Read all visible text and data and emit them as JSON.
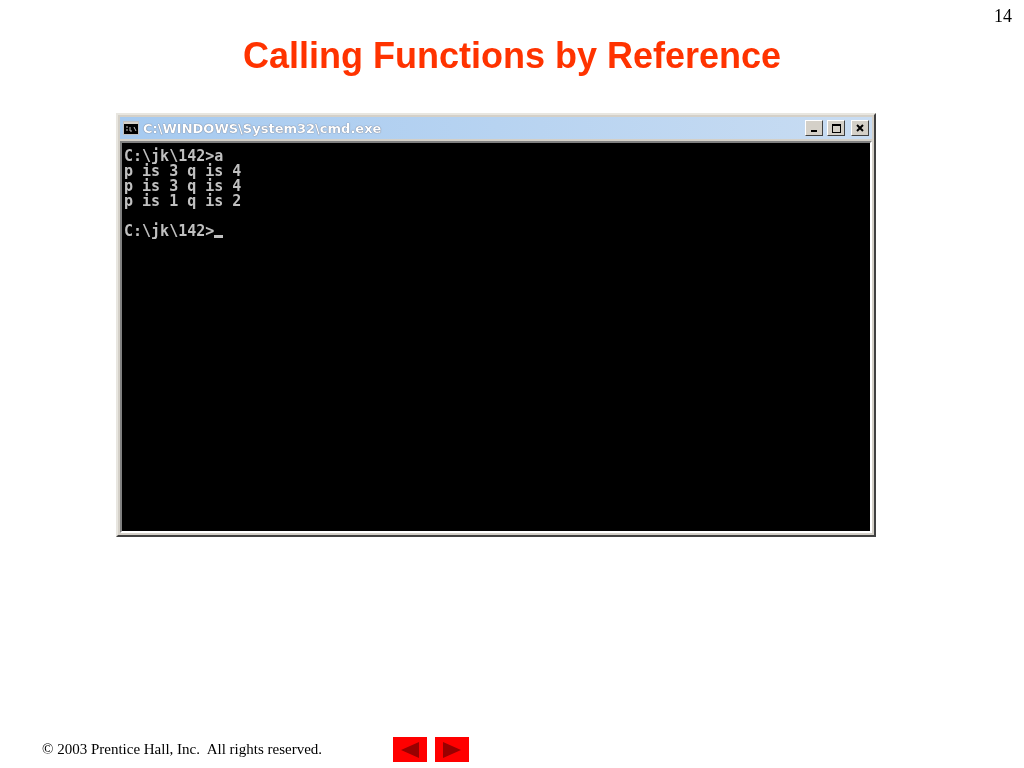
{
  "page_number": "14",
  "title": "Calling Functions by Reference",
  "window": {
    "title": "C:\\WINDOWS\\System32\\cmd.exe",
    "console_blocks": [
      [
        "C:\\jk\\142>a",
        "p is 3 q is 4",
        "p is 3 q is 4",
        "p is 1 q is 2"
      ],
      [
        "C:\\jk\\142>"
      ]
    ],
    "cursor": true
  },
  "footer": "© 2003 Prentice Hall, Inc.  All rights reserved."
}
